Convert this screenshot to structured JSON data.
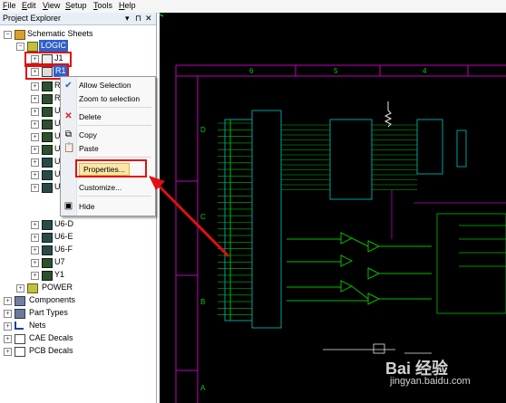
{
  "menubar": {
    "items": [
      "File",
      "Edit",
      "View",
      "Setup",
      "Tools",
      "Help"
    ],
    "underlined": [
      "F",
      "E",
      "V",
      "S",
      "T",
      "H"
    ]
  },
  "panel": {
    "title": "Project Explorer",
    "controls": [
      "▾",
      "⊓",
      "✕"
    ]
  },
  "tree": {
    "root": "Schematic Sheets",
    "logic": "LOGIC",
    "j1": "J1",
    "r1": "R1",
    "partial_r_a": "R",
    "partial_r_b": "R",
    "partial_u_a": "U",
    "partial_u_b": "U",
    "partial_u_c": "U",
    "partial_u_d": "U",
    "partial_u_e": "U",
    "partial_u_f": "U",
    "partial_u_g": "U",
    "u6d": "U6-D",
    "u6e": "U6-E",
    "u6f": "U6-F",
    "u7": "U7",
    "y1": "Y1",
    "power": "POWER",
    "components": "Components",
    "part_types": "Part Types",
    "nets": "Nets",
    "cae_decals": "CAE Decals",
    "pcb_decals": "PCB Decals"
  },
  "context_menu": {
    "allow_selection": "Allow Selection",
    "zoom_to_selection": "Zoom to selection",
    "delete": "Delete",
    "copy": "Copy",
    "paste": "Paste",
    "properties": "Properties...",
    "customize": "Customize...",
    "hide": "Hide"
  },
  "schematic": {
    "column_numbers": [
      "6",
      "5",
      "4"
    ],
    "row_letters": [
      "D",
      "C",
      "B",
      "A"
    ],
    "colors": {
      "border": "#c000c0",
      "wire": "#00c000",
      "part": "#00a0a0",
      "label": "#e8e8e8",
      "accent": "#ffff00"
    }
  },
  "watermark": {
    "brand": "Bai 经验",
    "url": "jingyan.baidu.com"
  }
}
